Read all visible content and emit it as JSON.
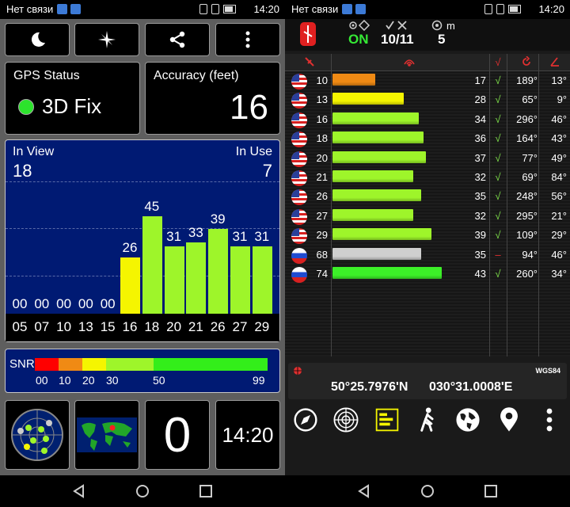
{
  "status_bar": {
    "carrier": "Нет связи",
    "time": "14:20"
  },
  "left": {
    "gps_status": {
      "title": "GPS Status",
      "value": "3D Fix",
      "indicator_color": "#2ce32c"
    },
    "accuracy": {
      "title": "Accuracy (feet)",
      "value": "16"
    },
    "view": {
      "in_view_label": "In View",
      "in_view_value": "18",
      "in_use_label": "In Use",
      "in_use_value": "7"
    },
    "bars": [
      {
        "prn": "05",
        "snr": "00",
        "level": 0,
        "color": "#000000"
      },
      {
        "prn": "07",
        "snr": "00",
        "level": 0,
        "color": "#000000"
      },
      {
        "prn": "10",
        "snr": "00",
        "level": 0,
        "color": "#000000"
      },
      {
        "prn": "13",
        "snr": "00",
        "level": 0,
        "color": "#000000"
      },
      {
        "prn": "15",
        "snr": "00",
        "level": 0,
        "color": "#000000"
      },
      {
        "prn": "16",
        "snr": "26",
        "level": 26,
        "color": "#f5f500"
      },
      {
        "prn": "18",
        "snr": "45",
        "level": 45,
        "color": "#9ef52a"
      },
      {
        "prn": "20",
        "snr": "31",
        "level": 31,
        "color": "#9ef52a"
      },
      {
        "prn": "21",
        "snr": "33",
        "level": 33,
        "color": "#9ef52a"
      },
      {
        "prn": "26",
        "snr": "39",
        "level": 39,
        "color": "#9ef52a"
      },
      {
        "prn": "27",
        "snr": "31",
        "level": 31,
        "color": "#9ef52a"
      },
      {
        "prn": "29",
        "snr": "31",
        "level": 31,
        "color": "#9ef52a"
      }
    ],
    "snr_legend": {
      "label": "SNR",
      "ticks": [
        "00",
        "10",
        "20",
        "30",
        "50",
        "99"
      ]
    },
    "counter": {
      "value": "0"
    },
    "clock": {
      "value": "14:20"
    }
  },
  "right": {
    "header": {
      "on_label": "ON",
      "sats_used": "10/11",
      "count": "5",
      "unit": "m"
    },
    "columns": {
      "check": "√"
    },
    "rows": [
      {
        "flag": "us",
        "prn": "10",
        "snr": "17",
        "snr_level": 17,
        "color": "#f08a14",
        "check": "√",
        "az": "189°",
        "el": "13°"
      },
      {
        "flag": "us",
        "prn": "13",
        "snr": "28",
        "snr_level": 28,
        "color": "#f5f500",
        "check": "√",
        "az": "65°",
        "el": "9°"
      },
      {
        "flag": "us",
        "prn": "16",
        "snr": "34",
        "snr_level": 34,
        "color": "#9ef52a",
        "check": "√",
        "az": "296°",
        "el": "46°"
      },
      {
        "flag": "us",
        "prn": "18",
        "snr": "36",
        "snr_level": 36,
        "color": "#9ef52a",
        "check": "√",
        "az": "164°",
        "el": "43°"
      },
      {
        "flag": "us",
        "prn": "20",
        "snr": "37",
        "snr_level": 37,
        "color": "#9ef52a",
        "check": "√",
        "az": "77°",
        "el": "49°"
      },
      {
        "flag": "us",
        "prn": "21",
        "snr": "32",
        "snr_level": 32,
        "color": "#9ef52a",
        "check": "√",
        "az": "69°",
        "el": "84°"
      },
      {
        "flag": "us",
        "prn": "26",
        "snr": "35",
        "snr_level": 35,
        "color": "#9ef52a",
        "check": "√",
        "az": "248°",
        "el": "56°"
      },
      {
        "flag": "us",
        "prn": "27",
        "snr": "32",
        "snr_level": 32,
        "color": "#9ef52a",
        "check": "√",
        "az": "295°",
        "el": "21°"
      },
      {
        "flag": "us",
        "prn": "29",
        "snr": "39",
        "snr_level": 39,
        "color": "#9ef52a",
        "check": "√",
        "az": "109°",
        "el": "29°"
      },
      {
        "flag": "ru",
        "prn": "68",
        "snr": "35",
        "snr_level": 35,
        "color": "#cfcfcf",
        "check": "–",
        "az": "94°",
        "el": "46°"
      },
      {
        "flag": "ru",
        "prn": "74",
        "snr": "43",
        "snr_level": 43,
        "color": "#3cf028",
        "check": "√",
        "az": "260°",
        "el": "34°"
      }
    ],
    "coords": {
      "datum": "WGS84",
      "lat": "50°25.7976'N",
      "lon": "030°31.0008'E"
    }
  }
}
